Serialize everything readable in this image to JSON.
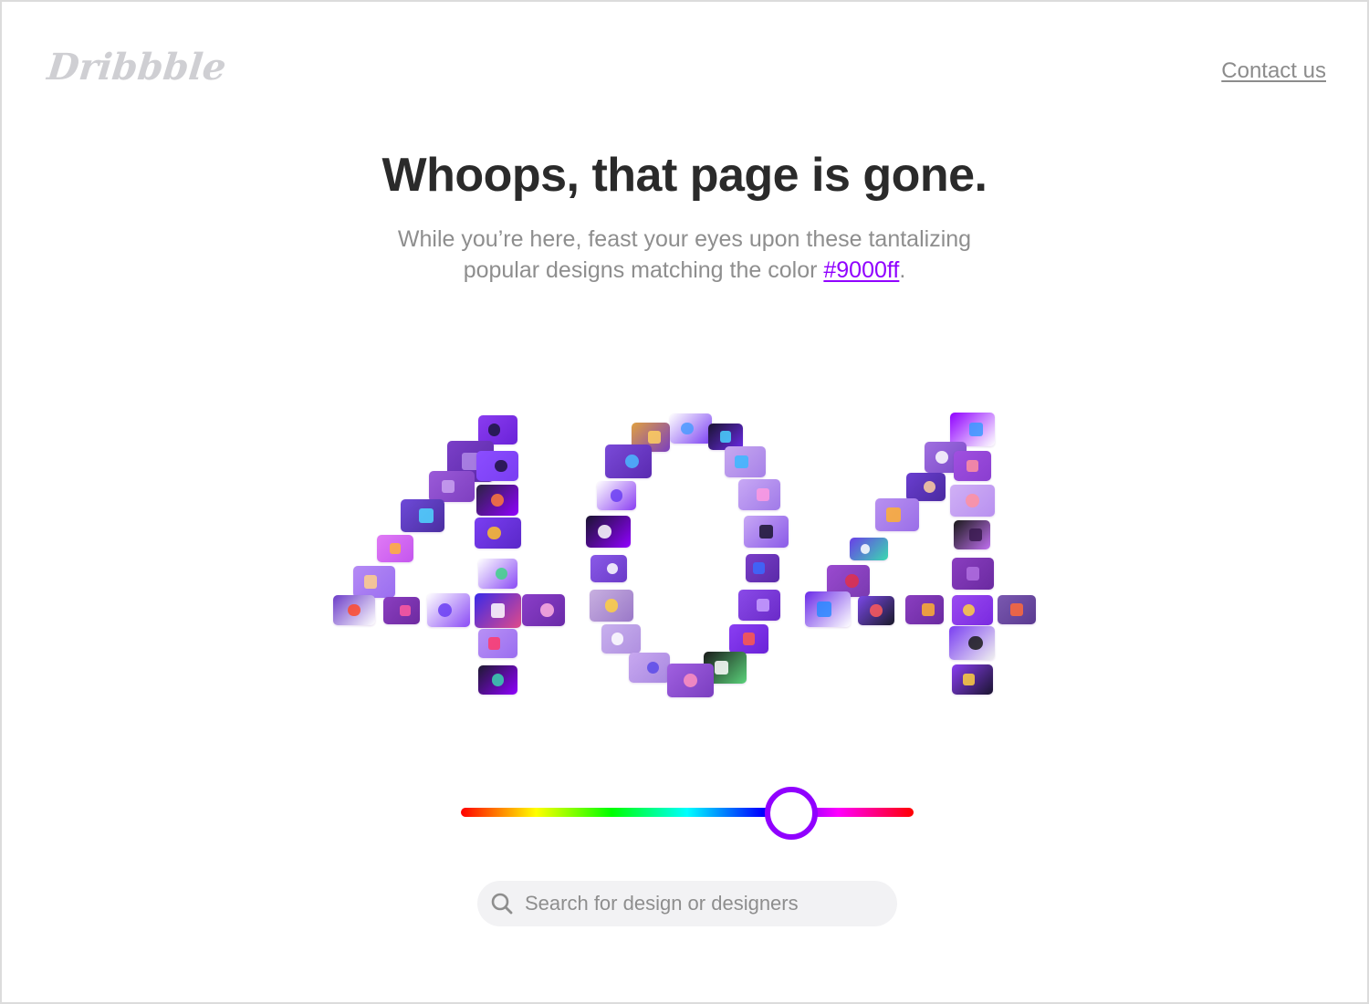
{
  "header": {
    "logo_text": "Dribbble",
    "contact_label": "Contact us"
  },
  "main": {
    "headline": "Whoops, that page is gone.",
    "subtext_before": "While you’re here, feast your eyes upon these tantalizing",
    "subtext_line2": "popular designs matching the color ",
    "color_link": "#9000ff",
    "subtext_after": "."
  },
  "mosaic": {
    "label": "404",
    "tiles": [
      {
        "digit": "4a",
        "c1": "#8a3cf0",
        "c2": "#6a22d8",
        "accent": "#1b1640"
      },
      {
        "digit": "4a",
        "c1": "#7a3fc8",
        "c2": "#5c2aa8",
        "accent": "#b08ae8"
      },
      {
        "digit": "4a",
        "c1": "#8b4dff",
        "c2": "#7a3ef2",
        "accent": "#1e1240"
      },
      {
        "digit": "4a",
        "c1": "#9a5ad8",
        "c2": "#7e3fc0",
        "accent": "#c9a1f0"
      },
      {
        "digit": "4a",
        "c1": "#2a2340",
        "c2": "#9000ff",
        "accent": "#ff7a3a"
      },
      {
        "digit": "4a",
        "c1": "#6e4ad8",
        "c2": "#4a2ea0",
        "accent": "#4fd7ff"
      },
      {
        "digit": "4a",
        "c1": "#7a3ef2",
        "c2": "#5a28c8",
        "accent": "#ffc12a"
      },
      {
        "digit": "4a",
        "c1": "#e07af5",
        "c2": "#c456ee",
        "accent": "#ffb23a"
      },
      {
        "digit": "4a",
        "c1": "#ffffff",
        "c2": "#8a4bf5",
        "accent": "#3fd28a"
      },
      {
        "digit": "4a",
        "c1": "#b58af5",
        "c2": "#9a6ef0",
        "accent": "#ffd08a"
      },
      {
        "digit": "4a",
        "c1": "#6c3cc8",
        "c2": "#ffffff",
        "accent": "#ff4a2a"
      },
      {
        "digit": "4a",
        "c1": "#8a3ec0",
        "c2": "#6e2aa0",
        "accent": "#ff5aa0"
      },
      {
        "digit": "4a",
        "c1": "#ffffff",
        "c2": "#8a4bf5",
        "accent": "#6a3ef2"
      },
      {
        "digit": "4a",
        "c1": "#3a2ae8",
        "c2": "#e04a8a",
        "accent": "#ffffff"
      },
      {
        "digit": "4a",
        "c1": "#8a3ec8",
        "c2": "#6a2aa8",
        "accent": "#ffb0e0"
      },
      {
        "digit": "4a",
        "c1": "#b890f5",
        "c2": "#9a6ef0",
        "accent": "#ff3a6a"
      },
      {
        "digit": "4a",
        "c1": "#1e1a30",
        "c2": "#9000ff",
        "accent": "#3ad2b0"
      },
      {
        "digit": "0",
        "c1": "#e0a040",
        "c2": "#7a3ec0",
        "accent": "#ffd060"
      },
      {
        "digit": "0",
        "c1": "#ffffff",
        "c2": "#7a3ef2",
        "accent": "#4a9aff"
      },
      {
        "digit": "0",
        "c1": "#1a1430",
        "c2": "#6a2ae8",
        "accent": "#4ad2ff"
      },
      {
        "digit": "0",
        "c1": "#7a4ad8",
        "c2": "#5a2ab0",
        "accent": "#4ab8ff"
      },
      {
        "digit": "0",
        "c1": "#c7a8f0",
        "c2": "#a782e8",
        "accent": "#3ab8ff"
      },
      {
        "digit": "0",
        "c1": "#ffffff",
        "c2": "#8a3ef2",
        "accent": "#6a3ef2"
      },
      {
        "digit": "0",
        "c1": "#c8a8f5",
        "c2": "#a07ae8",
        "accent": "#ff9ae0"
      },
      {
        "digit": "0",
        "c1": "#1a1430",
        "c2": "#9000ff",
        "accent": "#ffffff"
      },
      {
        "digit": "0",
        "c1": "#c8a8f5",
        "c2": "#8a5ae8",
        "accent": "#1a1430"
      },
      {
        "digit": "0",
        "c1": "#8a5ae8",
        "c2": "#6a3ac8",
        "accent": "#ffffff"
      },
      {
        "digit": "0",
        "c1": "#7a3ec8",
        "c2": "#5a2aa8",
        "accent": "#3a6aff"
      },
      {
        "digit": "0",
        "c1": "#c8b0e0",
        "c2": "#9a78c8",
        "accent": "#ffd040"
      },
      {
        "digit": "0",
        "c1": "#8a4ae8",
        "c2": "#6a2ac8",
        "accent": "#c8a0ff"
      },
      {
        "digit": "0",
        "c1": "#c8b0ee",
        "c2": "#b090e0",
        "accent": "#ffffff"
      },
      {
        "digit": "0",
        "c1": "#8a3ef2",
        "c2": "#6a22d8",
        "accent": "#ff5a4a"
      },
      {
        "digit": "0",
        "c1": "#c8a8f0",
        "c2": "#a888e0",
        "accent": "#5a4ae8"
      },
      {
        "digit": "0",
        "c1": "#1a1a1a",
        "c2": "#5ad27a",
        "accent": "#ffffff"
      },
      {
        "digit": "0",
        "c1": "#a060e0",
        "c2": "#7a3ec0",
        "accent": "#ff90c0"
      },
      {
        "digit": "4b",
        "c1": "#9000ff",
        "c2": "#ffffff",
        "accent": "#3a9aff"
      },
      {
        "digit": "4b",
        "c1": "#a070e0",
        "c2": "#7a48c8",
        "accent": "#ffffff"
      },
      {
        "digit": "4b",
        "c1": "#a050e0",
        "c2": "#8a3ed0",
        "accent": "#ff90a0"
      },
      {
        "digit": "4b",
        "c1": "#6a3ed0",
        "c2": "#4a2aa0",
        "accent": "#ffd0a0"
      },
      {
        "digit": "4b",
        "c1": "#b890f0",
        "c2": "#9a6ee8",
        "accent": "#ffb030"
      },
      {
        "digit": "4b",
        "c1": "#d0b0f5",
        "c2": "#b890f0",
        "accent": "#ff90a0"
      },
      {
        "digit": "4b",
        "c1": "#1a1a1a",
        "c2": "#c070f0",
        "accent": "#3a1a50"
      },
      {
        "digit": "4b",
        "c1": "#6a3ee8",
        "c2": "#3adab0",
        "accent": "#ffffff"
      },
      {
        "digit": "4b",
        "c1": "#8a3ec0",
        "c2": "#6a2aa0",
        "accent": "#b070e0"
      },
      {
        "digit": "4b",
        "c1": "#9a4ad0",
        "c2": "#7a3ab0",
        "accent": "#e0304a"
      },
      {
        "digit": "4b",
        "c1": "#6a2ae8",
        "c2": "#ffffff",
        "accent": "#2a8aff"
      },
      {
        "digit": "4b",
        "c1": "#7a48e8",
        "c2": "#1a1a2a",
        "accent": "#ff5a5a"
      },
      {
        "digit": "4b",
        "c1": "#8a3ec0",
        "c2": "#6a2aa0",
        "accent": "#ffb030"
      },
      {
        "digit": "4b",
        "c1": "#9a4af0",
        "c2": "#7a2ae0",
        "accent": "#ffd040"
      },
      {
        "digit": "4b",
        "c1": "#7a58b0",
        "c2": "#5a3a90",
        "accent": "#ff6a3a"
      },
      {
        "digit": "4b",
        "c1": "#7a3ef2",
        "c2": "#f0f0f0",
        "accent": "#1a1a1a"
      },
      {
        "digit": "4b",
        "c1": "#8a3ef2",
        "c2": "#1a1430",
        "accent": "#ffd040"
      }
    ]
  },
  "color_slider": {
    "label": "Color hue slider",
    "selected_color": "#9000ff",
    "value_fraction": 0.73
  },
  "search": {
    "placeholder": "Search for design or designers",
    "value": ""
  },
  "icons": {
    "search": "search-icon"
  }
}
